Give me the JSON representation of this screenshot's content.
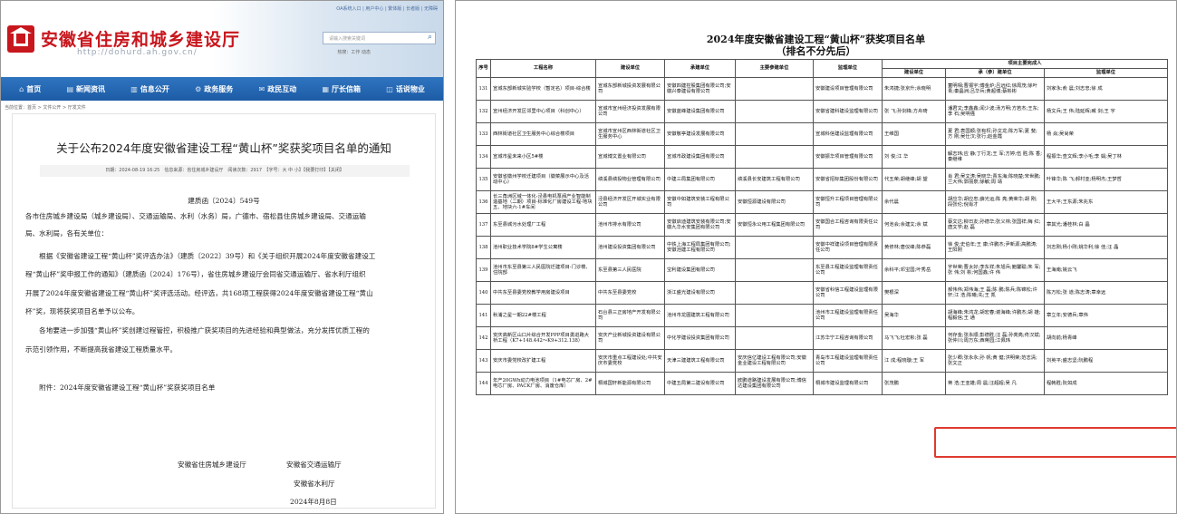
{
  "site": {
    "title": "安徽省住房和城乡建设厅",
    "url": "http://dohurd.ah.gov.cn/",
    "top_links": "OA系统入口 | 用户中心 | 繁体版 | 长者版 | 无障碍",
    "search_placeholder": "请输入搜索关键词",
    "hot": "热搜：工作 动态"
  },
  "nav": [
    {
      "icon": "⌂",
      "label": "首页"
    },
    {
      "icon": "▤",
      "label": "新闻资讯"
    },
    {
      "icon": "▥",
      "label": "信息公开"
    },
    {
      "icon": "⚙",
      "label": "政务服务"
    },
    {
      "icon": "✉",
      "label": "政民互动"
    },
    {
      "icon": "▦",
      "label": "厅长信箱"
    },
    {
      "icon": "◫",
      "label": "话说物业"
    }
  ],
  "breadcrumb": "当前位置：首页 > 文件公开 > 厅发文件",
  "article": {
    "title": "关于公布2024年度安徽省建设工程“黄山杯”奖获奖项目名单的通知",
    "meta": "日期：2024-08-19 16:25　信息来源：省住房城乡建设厅　阅读次数：2917　【字号：大 中 小】【我要打印】【关闭】",
    "doc_number": "建质函〔2024〕549号",
    "paragraphs": [
      "各市住房城乡建设局（城乡建设局）、交通运输局、水利（水务）局，广德市、宿松县住房城乡建设局、交通运输",
      "局、水利局，各有关单位：",
      "　　根据《安徽省建设工程“黄山杯”奖评选办法》（建质〔2022〕39号）和《关于组织开展2024年度安徽省建设工",
      "程“黄山杯”奖申报工作的通知》（建质函〔2024〕176号），省住房城乡建设厅会同省交通运输厅、省水利厅组织",
      "开展了2024年度安徽省建设工程“黄山杯”奖评选活动。经评选，共168项工程获得2024年度安徽省建设工程“黄山",
      "杯”奖，现将获奖项目名单予以公布。",
      "　　各地要进一步加强“黄山杯”奖创建过程管控，积极推广获奖项目的先进经验和典型做法，充分发挥优质工程的",
      "示范引领作用，不断提高我省建设工程质量水平。",
      "　　附件：2024年度安徽省建设工程“黄山杯”奖获奖项目名单"
    ],
    "signatures": {
      "org1": "安徽省住房城乡建设厅",
      "org2": "安徽省交通运输厅",
      "org3": "安徽省水利厅",
      "date": "2024年8月8日"
    }
  },
  "list": {
    "title": "2024年度安徽省建设工程“黄山杯”获奖项目名单",
    "subtitle": "（排名不分先后）",
    "headers": {
      "no": "序号",
      "name": "工程名称",
      "builder": "建设单位",
      "contractor": "承建单位",
      "participant": "主要参建单位",
      "supervisor": "监理单位",
      "group": "项目主要完成人",
      "p_builder": "建设单位",
      "p_contractor": "承（参）建单位",
      "p_supervisor": "监理单位"
    },
    "rows": [
      {
        "no": "131",
        "name": "宣城东部新城实验学校（暂定名）项目-综合楼",
        "builder": "宣城东部新城投资发展有限公司",
        "contractor": "安徽四建控股集团有限公司;安徽兴泰建设有限公司",
        "participant": "",
        "supervisor": "安徽建设项目管理有限公司",
        "p_builder": "朱鸿捷;张京升;余晓明",
        "p_contractor": "童明相;曹振宇;傅金炉;吕远红;徐周茂;徐叶青;秦晶洲;吕华兵;黄超博;蔡彬彬",
        "p_supervisor": "刘家永;俞 晨;刘志忠;徐 成"
      },
      {
        "no": "132",
        "name": "宣州经济开发区邻里中心项目（科创中心）",
        "builder": "宣城市宣州经济投资发展有限公司",
        "contractor": "安徽蓝峰建设集团有限公司",
        "participant": "",
        "supervisor": "安徽省建科建设监理有限公司",
        "p_builder": "张 飞;孙剑锋;方舟琦",
        "p_contractor": "潘君文;李鑫鑫;闻少波;汤方明;方若杰;王东;李 石;吴明强",
        "p_supervisor": "杨文兵;王 伟;陆延辉;臧 剑;王 宇"
      },
      {
        "no": "133",
        "name": "西林街道社区卫生服务中心综合楼项目",
        "builder": "宣城市宣州区西林街道社区卫生服务中心",
        "contractor": "安徽敬亭建设发展有限公司",
        "participant": "",
        "supervisor": "宣城科信建设监理有限公司",
        "p_builder": "王维国",
        "p_contractor": "夏 君;袁国顺;张有权;孙文龙;陈万军;夏 斐;方 刚;吴仕汉;张行;赵金霞",
        "p_supervisor": "杨 焱;吴尚荣"
      },
      {
        "no": "134",
        "name": "宣城市星未来小区5#楼",
        "builder": "宣城博文置业有限公司",
        "contractor": "宣城市政建设集团有限公司",
        "participant": "",
        "supervisor": "安徽振华项目管理有限公司",
        "p_builder": "刘 俊;江 华",
        "p_contractor": "解志玮;应 静;丁行龙;王 军;方婷;伍 胜;陈 香;秦继维",
        "p_supervisor": "程振华;查文辉;李小毛;李 娟;吴丁林"
      },
      {
        "no": "135",
        "name": "安徽省徽州学校迁建项目（徽菜展示中心及活动中心）",
        "builder": "绩溪县绩投物业管理有限公司",
        "contractor": "中建三局集团有限公司",
        "participant": "绩溪县长安建筑工程有限公司",
        "supervisor": "安徽省招标集团股份有限公司",
        "p_builder": "代玉荣;胡继峰;胡 望",
        "p_contractor": "肖 君;吴文涛;吴晓华;青东海;陈晓楚;宋世鹏;兰大伟;郭丽泉;徐敏;周 靖",
        "p_supervisor": "叶锋华;陈 飞;郝村亚;杨明杰;王梦哲"
      },
      {
        "no": "136",
        "name": "长三角洲区域一体化-泾县电机泵阀产业智能制造基地（二期）项目-标准化厂房建设工程-地块五、地块六-1#车间",
        "builder": "泾县经济开发区开城实业有限公司",
        "contractor": "安徽中如建筑安装工程有限公司",
        "participant": "安徽恒源建设有限公司",
        "supervisor": "安徽恒升工程项目管理有限公司",
        "p_builder": "余代晨",
        "p_contractor": "胡应华;胡应忠;薛光运;陈 亮;黄荣华;胡 刚;段张伦;倪肖才",
        "p_supervisor": "王大平;王东源;朱兆东"
      },
      {
        "no": "137",
        "name": "东至县城污水处理厂工程",
        "builder": "池州市排水有限公司",
        "contractor": "安徽启迪建筑安装有限公司;安徽九华水安集团有限公司",
        "participant": "安徽恒永公用工程集团有限公司",
        "supervisor": "安徽国合工程咨询有限责任公司",
        "p_builder": "何池会;余建文;余 斌",
        "p_contractor": "蔡文达;柳日友;孙德华;张义林;张国祥;梅 红;唐文学;赵 磊",
        "p_supervisor": "章其光;潘桂林;白 晶"
      },
      {
        "no": "138",
        "name": "池州职业技术学院8#学生公寓楼",
        "builder": "池州建设投资集团有限公司",
        "contractor": "中铁上海工程局集团有限公司;安徽池建工程有限公司",
        "participant": "",
        "supervisor": "安徽中祥建设项目管理有限责任公司",
        "p_builder": "黄修林;唐仪峰;陈恭磊",
        "p_contractor": "徐 俊;史伯年;王 康;许鹏杰;尹新源;高鹏涛;王阳刚",
        "p_supervisor": "刘志刚;杨小刚;姚华利;徐 佳;汪 晶"
      },
      {
        "no": "139",
        "name": "池州市东至县第三人民医院迁建项目-门诊楼、住院部",
        "builder": "东至县第三人民医院",
        "contractor": "宝利建设集团有限公司",
        "participant": "",
        "supervisor": "东至县工程建设监理有限责任公司",
        "p_builder": "余科平;邓宝国;叶秀岳",
        "p_contractor": "宇世荣;曹太好;李东祥;朱旭兵;鲍馨聪;朱 军;张 伟;刘 彬;何国鑫;许 伟",
        "p_supervisor": "王海南;姚云飞"
      },
      {
        "no": "140",
        "name": "中共东至县委党校教学用房建设项目",
        "builder": "中共东至县委党校",
        "contractor": "浙江盛光建设有限公司",
        "participant": "",
        "supervisor": "安徽省科信工程建设监理有限公司",
        "p_builder": "樊根深",
        "p_contractor": "郝伟伟;郑伟海;王 磊;陈 鹏;陈兵;陈锦松;许 轩;江 浩;陈曦;先;王 凯",
        "p_supervisor": "陈万松;张 道;陈志涛;章幸远"
      },
      {
        "no": "141",
        "name": "秋浦之星一期22#楼工程",
        "builder": "石台县三正房地产开发有限公司",
        "contractor": "池州市龙圃建筑工程有限公司",
        "participant": "",
        "supervisor": "池州市工程建设监理有限责任公司",
        "p_builder": "吴海华",
        "p_contractor": "胡海峰;朱鸿龙;胡宏春;谢海峰;许鹏杰;胡 雄;程毅信;王 通",
        "p_supervisor": "章立年;安德兵;章伟"
      },
      {
        "no": "142",
        "name": "安庆高新区山口片综合开发PPP项目勇进路大桥工程（K7+148.442～K9+312.138）",
        "builder": "安庆产业新城投资建设有限公司",
        "contractor": "中化学建设投资集团有限公司",
        "participant": "",
        "supervisor": "江苏华宁工程咨询有限公司",
        "p_builder": "马飞飞;杜宏彬;张 磊",
        "p_contractor": "何存金;张永顺;彭德胜;汪 磊;孙亮亮;佟汉斌;张仲川;周万东;西蒋园;江佩玮",
        "p_supervisor": "胡向前;杨青峰"
      },
      {
        "no": "143",
        "name": "安庆市委党校改扩建工程",
        "builder": "安庆市重点工程建设处;中共安庆市委党校",
        "contractor": "天津三建建筑工程有限公司",
        "participant": "安庆信亿建设工程有限公司;安徽金业建设工程有限公司",
        "supervisor": "青岛市工程建设监理有限责任公司",
        "p_builder": "江 成;程晓璇;王 军",
        "p_contractor": "张少卿;张永永;孙 帆;黄 健;洪明荣;范志清;张文正",
        "p_supervisor": "刘英平;盛志坚;阮鹏程"
      },
      {
        "no": "144",
        "name": "年产20GWh动力电池项目（1#电芯厂房、2#电芯厂房、PACK厂房、消废仓库）",
        "builder": "桐城国轩新能源有限公司",
        "contractor": "中建五局第二建设有限公司",
        "participant": "欧鹏道路建设发展有限公司;博信达建设集团有限公司",
        "supervisor": "桐城市建设监理有限公司",
        "p_builder": "张茂鹏",
        "p_contractor": "蒋 浩;王亚雄;周 晨;汪超超;吴 凡",
        "p_supervisor": "程韩胜;阮如成"
      }
    ],
    "highlighted_row": "142",
    "highlight_color": "#e03a30"
  },
  "colors": {
    "brand_red": "#c8161d",
    "nav_blue": "#2468b4"
  }
}
